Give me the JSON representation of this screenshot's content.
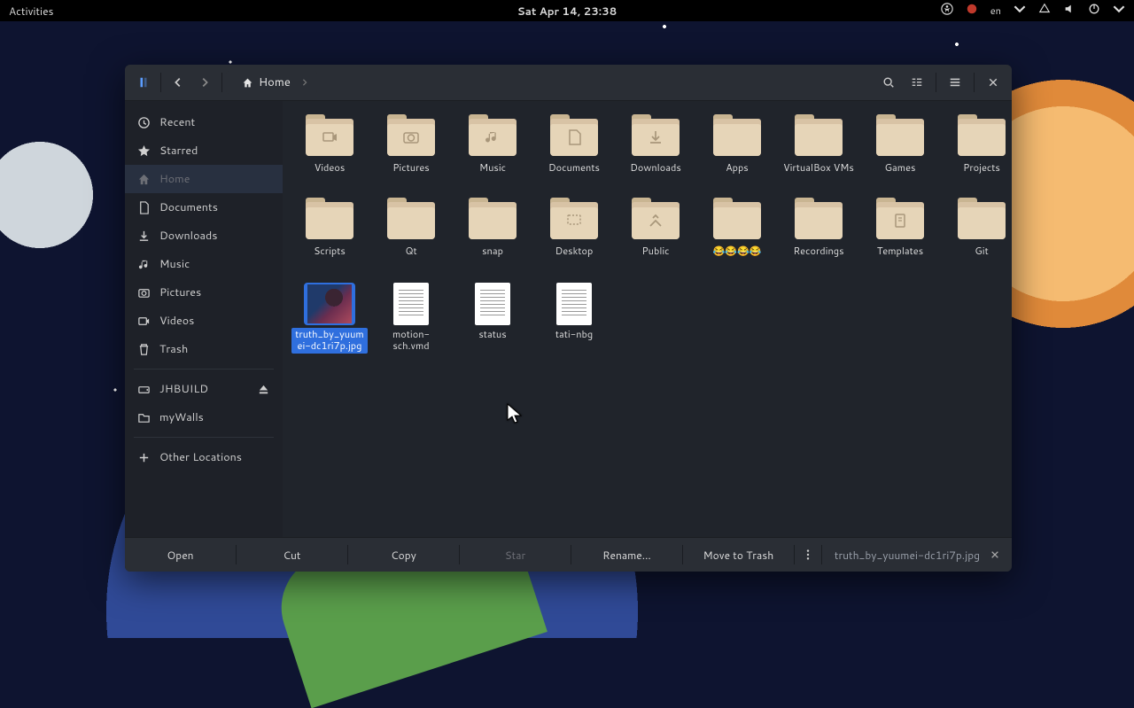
{
  "panel": {
    "activities": "Activities",
    "clock": "Sat Apr 14, 23:38",
    "lang": "en"
  },
  "titlebar": {
    "location_label": "Home"
  },
  "sidebar": {
    "items": [
      {
        "icon": "clock",
        "label": "Recent"
      },
      {
        "icon": "star",
        "label": "Starred"
      },
      {
        "icon": "home",
        "label": "Home"
      },
      {
        "icon": "doc",
        "label": "Documents"
      },
      {
        "icon": "download",
        "label": "Downloads"
      },
      {
        "icon": "music",
        "label": "Music"
      },
      {
        "icon": "camera",
        "label": "Pictures"
      },
      {
        "icon": "video",
        "label": "Videos"
      },
      {
        "icon": "trash",
        "label": "Trash"
      },
      {
        "icon": "drive",
        "label": "JHBUILD",
        "eject": true
      },
      {
        "icon": "folder",
        "label": "myWalls"
      },
      {
        "icon": "plus",
        "label": "Other Locations"
      }
    ]
  },
  "folders_row1": [
    {
      "label": "Videos",
      "glyph": "video"
    },
    {
      "label": "Pictures",
      "glyph": "camera"
    },
    {
      "label": "Music",
      "glyph": "music"
    },
    {
      "label": "Documents",
      "glyph": "doc"
    },
    {
      "label": "Downloads",
      "glyph": "download"
    },
    {
      "label": "Apps",
      "glyph": ""
    },
    {
      "label": "VirtualBox VMs",
      "glyph": ""
    },
    {
      "label": "Games",
      "glyph": ""
    },
    {
      "label": "Projects",
      "glyph": ""
    }
  ],
  "folders_row2": [
    {
      "label": "Scripts",
      "glyph": ""
    },
    {
      "label": "Qt",
      "glyph": ""
    },
    {
      "label": "snap",
      "glyph": ""
    },
    {
      "label": "Desktop",
      "glyph": "desktop"
    },
    {
      "label": "Public",
      "glyph": "public"
    },
    {
      "label": "😂😂😂😂",
      "glyph": ""
    },
    {
      "label": "Recordings",
      "glyph": ""
    },
    {
      "label": "Templates",
      "glyph": "template"
    },
    {
      "label": "Git",
      "glyph": ""
    }
  ],
  "files": [
    {
      "label": "truth_by_yuumei-dc1ri7p.jpg",
      "kind": "image",
      "selected": true
    },
    {
      "label": "motion-sch.vmd",
      "kind": "doc"
    },
    {
      "label": "status",
      "kind": "doc"
    },
    {
      "label": "tati-nbg",
      "kind": "doc"
    }
  ],
  "actions": {
    "open": "Open",
    "cut": "Cut",
    "copy": "Copy",
    "star": "Star",
    "rename": "Rename…",
    "trash": "Move to Trash",
    "selection": "truth_by_yuumei-dc1ri7p.jpg"
  }
}
